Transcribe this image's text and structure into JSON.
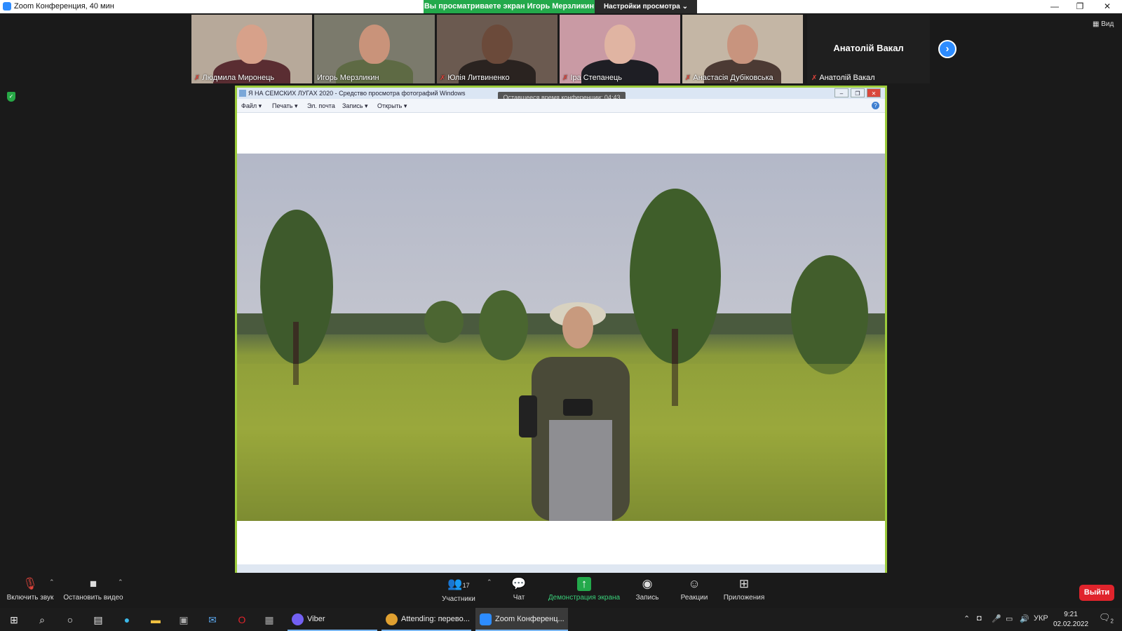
{
  "window": {
    "title": "Zoom Конференция, 40 мин",
    "minimize": "—",
    "restore": "❐",
    "close": "✕"
  },
  "share_banner": "Вы просматриваете экран Игорь Мерзликин",
  "view_options": "Настройки просмотра ⌄",
  "view_button": "Вид",
  "participants": [
    {
      "name": "Людмила Миронець",
      "bg": "#b7a99a",
      "skin": "#d7a18a",
      "shirt": "#5a2d32"
    },
    {
      "name": "Игорь Мерзликин",
      "bg": "#7b7a6c",
      "skin": "#c9937a",
      "shirt": "#5e6a44"
    },
    {
      "name": "Юлія Литвиненко",
      "bg": "#6b5a50",
      "skin": "#6b4a3a",
      "shirt": "#2a2320"
    },
    {
      "name": "Іра Степанець",
      "bg": "#c99aa4",
      "skin": "#e0b4a2",
      "shirt": "#1e1e24"
    },
    {
      "name": "Анастасія Дубіковська",
      "bg": "#c4b6a5",
      "skin": "#c8947e",
      "shirt": "#4c3a34"
    }
  ],
  "name_tile": {
    "big": "Анатолій Вакал",
    "small": "Анатолій Вакал"
  },
  "next_icon": "›",
  "shared_window": {
    "title": "Я НА СЕМСКИХ ЛУГАХ 2020 - Средство просмотра фотографий Windows",
    "time_remaining": "Оставшееся время конференции: 04:43",
    "menu": [
      "Файл ▾",
      "Печать ▾",
      "Эл. почта",
      "Запись ▾",
      "Открыть ▾"
    ],
    "help": "?"
  },
  "toolbar": {
    "mute": "Включить звук",
    "video": "Остановить видео",
    "participants": "Участники",
    "participants_count": "17",
    "chat": "Чат",
    "share": "Демонстрация экрана",
    "record": "Запись",
    "reactions": "Реакции",
    "apps": "Приложения",
    "leave": "Выйти"
  },
  "taskbar": {
    "viber": "Viber",
    "chrome": "Attending: перево...",
    "zoom": "Zoom Конференц...",
    "lang": "УКР",
    "time": "9:21",
    "date": "02.02.2022",
    "notifications": "2"
  },
  "colors": {
    "accent": "#2d8cff",
    "share_green": "#23a94b",
    "leave_red": "#e0242c",
    "share_border": "#9ccb3b"
  }
}
